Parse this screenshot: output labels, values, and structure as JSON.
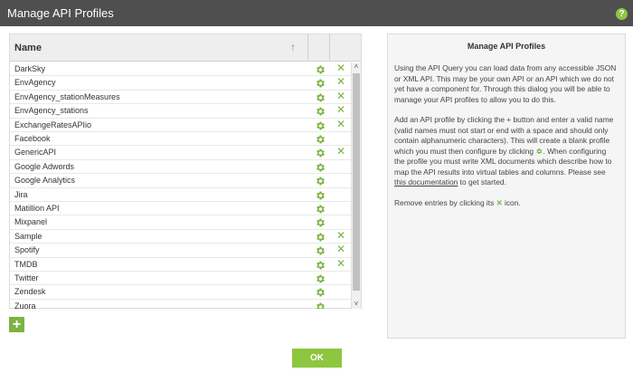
{
  "window": {
    "title": "Manage API Profiles",
    "help_icon": "?"
  },
  "grid": {
    "column_name": "Name",
    "sort_indicator": "↑",
    "rows": [
      {
        "name": "DarkSky",
        "deletable": true
      },
      {
        "name": "EnvAgency",
        "deletable": true
      },
      {
        "name": "EnvAgency_stationMeasures",
        "deletable": true
      },
      {
        "name": "EnvAgency_stations",
        "deletable": true
      },
      {
        "name": "ExchangeRatesAPIio",
        "deletable": true
      },
      {
        "name": "Facebook",
        "deletable": false
      },
      {
        "name": "GenericAPI",
        "deletable": true
      },
      {
        "name": "Google Adwords",
        "deletable": false
      },
      {
        "name": "Google Analytics",
        "deletable": false
      },
      {
        "name": "Jira",
        "deletable": false
      },
      {
        "name": "Matillion API",
        "deletable": false
      },
      {
        "name": "Mixpanel",
        "deletable": false
      },
      {
        "name": "Sample",
        "deletable": true
      },
      {
        "name": "Spotify",
        "deletable": true
      },
      {
        "name": "TMDB",
        "deletable": true
      },
      {
        "name": "Twitter",
        "deletable": false
      },
      {
        "name": "Zendesk",
        "deletable": false
      },
      {
        "name": "Zuora",
        "deletable": false
      }
    ],
    "scroll_up": "˄",
    "scroll_down": "˅"
  },
  "add_button": "+",
  "help": {
    "title": "Manage API Profiles",
    "p1": "Using the API Query you can load data from any accessible JSON or XML API. This may be your own API or an API which we do not yet have a component for. Through this dialog you will be able to manage your API profiles to allow you to do this.",
    "p2_before": "Add an API profile by clicking the + button and enter a valid name (valid names must not start or end with a space and should only contain alphanumeric characters). This will create a blank profile which you must then configure by clicking",
    "p2_after": ". When configuring the profile you must write XML documents which describe how to map the API results into virtual tables and columns. Please see",
    "p2_link": "this documentation",
    "p2_end": "to get started.",
    "p3_before": "Remove entries by clicking its",
    "p3_after": "icon."
  },
  "ok_button": "OK",
  "colors": {
    "titlebar": "#4f4f4f",
    "accent": "#8dc63f"
  }
}
